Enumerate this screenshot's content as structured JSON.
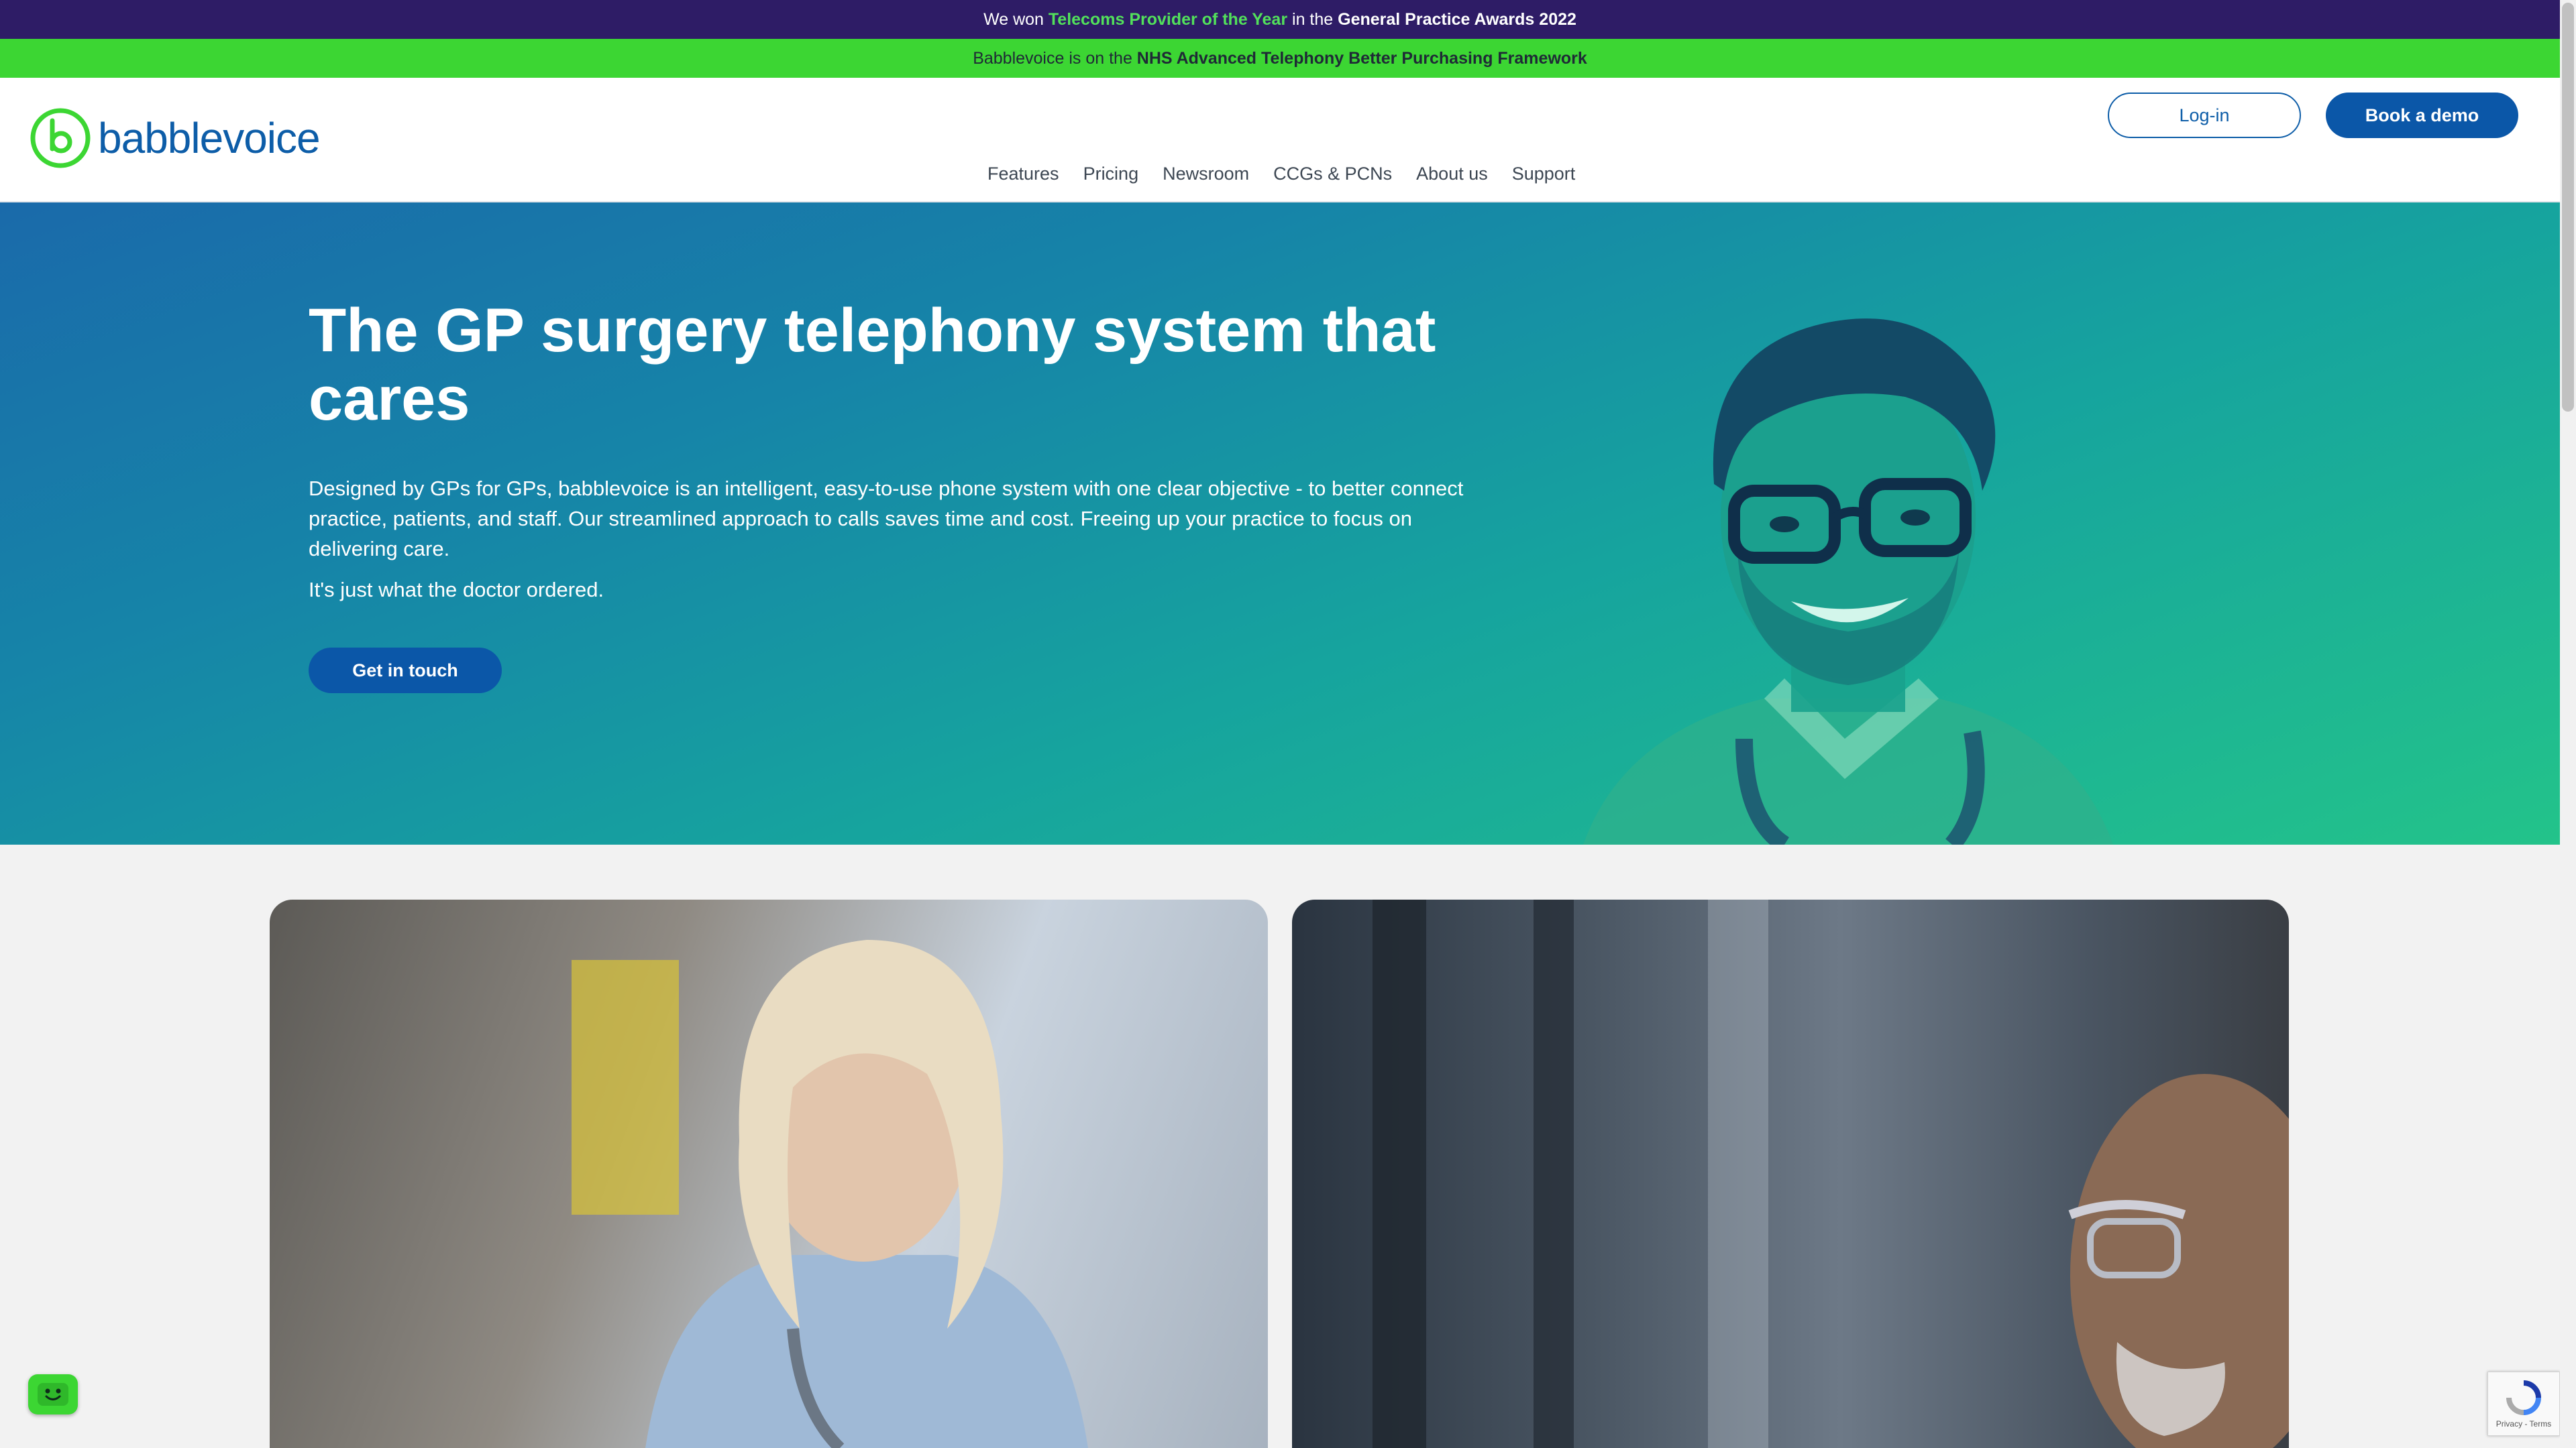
{
  "announcements": {
    "award_prefix": "We won ",
    "award_highlight": "Telecoms Provider of the Year",
    "award_middle": " in the ",
    "award_event": "General Practice Awards 2022",
    "framework_prefix": "Babblevoice is on the ",
    "framework_name": "NHS Advanced Telephony Better Purchasing Framework"
  },
  "header": {
    "logo_text": "babblevoice",
    "login_label": "Log-in",
    "demo_label": "Book a demo",
    "nav": [
      "Features",
      "Pricing",
      "Newsroom",
      "CCGs & PCNs",
      "About us",
      "Support"
    ]
  },
  "hero": {
    "title": "The GP surgery telephony system that cares",
    "description": "Designed by GPs for GPs, babblevoice is an intelligent, easy-to-use phone system with one clear objective - to better connect practice, patients, and staff. Our streamlined approach to calls saves time and cost. Freeing up your practice to focus on delivering care.",
    "tagline": "It's just what the doctor ordered.",
    "cta_label": "Get in touch"
  },
  "widgets": {
    "recaptcha_terms": "Privacy - Terms",
    "chat_icon": "chat-face-icon"
  },
  "colors": {
    "purple_bar": "#2e1c66",
    "green_bar": "#3cd633",
    "brand_blue": "#0b57a8",
    "highlight_green": "#52e05b"
  }
}
